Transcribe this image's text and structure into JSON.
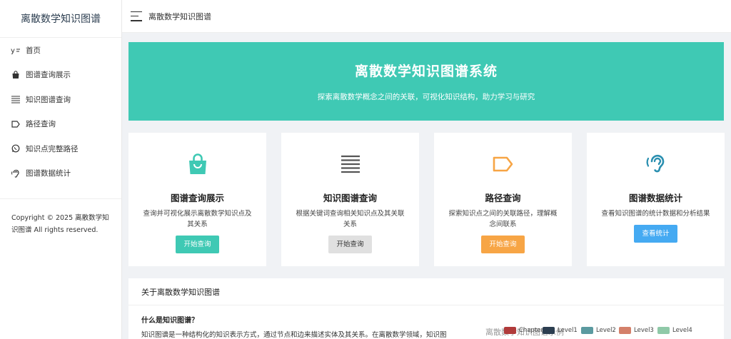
{
  "sidebar": {
    "brand": "离散数学知识图谱",
    "items": [
      {
        "label": "首页",
        "icon": "home-icon"
      },
      {
        "label": "图谱查询展示",
        "icon": "bag-icon"
      },
      {
        "label": "知识图谱查询",
        "icon": "list-icon"
      },
      {
        "label": "路径查询",
        "icon": "tag-icon"
      },
      {
        "label": "知识点完整路径",
        "icon": "whatsapp-icon"
      },
      {
        "label": "图谱数据统计",
        "icon": "ear-icon"
      }
    ],
    "copyright": "Copyright © 2025 离散数学知识图谱 All rights reserved."
  },
  "header": {
    "title": "离散数学知识图谱"
  },
  "hero": {
    "title": "离散数学知识图谱系统",
    "subtitle": "探索离散数学概念之间的关联，可视化知识结构，助力学习与研究",
    "color": "#3fc9b4"
  },
  "cards": [
    {
      "title": "图谱查询展示",
      "desc": "查询并可视化展示离散数学知识点及其关系",
      "button": "开始查询",
      "icon": "bag-icon",
      "color": "#3fc9b4"
    },
    {
      "title": "知识图谱查询",
      "desc": "根据关键词查询相关知识点及其关联关系",
      "button": "开始查询",
      "icon": "list-icon",
      "color": "#9e9e9e"
    },
    {
      "title": "路径查询",
      "desc": "探索知识点之间的关联路径，理解概念间联系",
      "button": "开始查询",
      "icon": "tag-icon",
      "color": "#f7a545"
    },
    {
      "title": "图谱数据统计",
      "desc": "查看知识图谱的统计数据和分析结果",
      "button": "查看统计",
      "icon": "ear-icon",
      "color": "#45aaf2"
    }
  ],
  "about": {
    "heading": "关于离散数学知识图谱",
    "question": "什么是知识图谱？",
    "answer": "知识图谱是一种结构化的知识表示方式，通过节点和边来描述实体及其关系。在离散数学领域，知识图"
  },
  "legend": {
    "title": "离散数学知识图谱示例",
    "items": [
      {
        "label": "Chapter",
        "color": "#b03a3a"
      },
      {
        "label": "Level1",
        "color": "#2c3e50"
      },
      {
        "label": "Level2",
        "color": "#5b9aa0"
      },
      {
        "label": "Level3",
        "color": "#d4806a"
      },
      {
        "label": "Level4",
        "color": "#8fc9a8"
      }
    ]
  }
}
